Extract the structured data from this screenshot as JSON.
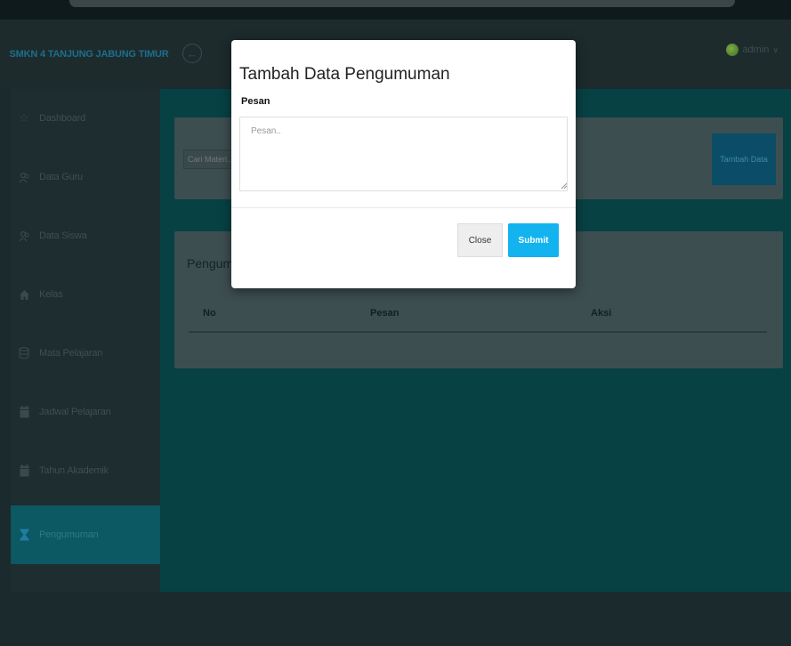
{
  "header": {
    "brand": "SMKN 4 TANJUNG JABUNG TIMUR",
    "user_name": "admin"
  },
  "sidebar": {
    "items": [
      {
        "label": "Dashboard",
        "icon": "star-icon",
        "active": false
      },
      {
        "label": "Data Guru",
        "icon": "users-icon",
        "active": false
      },
      {
        "label": "Data Siswa",
        "icon": "users-icon",
        "active": false
      },
      {
        "label": "Kelas",
        "icon": "home-icon",
        "active": false
      },
      {
        "label": "Mata Pelajaran",
        "icon": "database-icon",
        "active": false
      },
      {
        "label": "Jadwal Pelajaran",
        "icon": "calendar-icon",
        "active": false
      },
      {
        "label": "Tahun Akademik",
        "icon": "calendar-icon",
        "active": false
      },
      {
        "label": "Pengumuman",
        "icon": "hourglass-icon",
        "active": true
      }
    ]
  },
  "main": {
    "search_placeholder": "Cari Materi..",
    "add_button": "Tambah Data",
    "table_title": "Pengumuman",
    "columns": [
      "No",
      "Pesan",
      "Aksi"
    ]
  },
  "modal": {
    "title": "Tambah Data Pengumuman",
    "field_label": "Pesan",
    "field_placeholder": "Pesan..",
    "close_label": "Close",
    "submit_label": "Submit"
  },
  "colors": {
    "accent": "#12b3ee",
    "sidebar_active": "#0c5863",
    "content_bg": "#074144"
  }
}
